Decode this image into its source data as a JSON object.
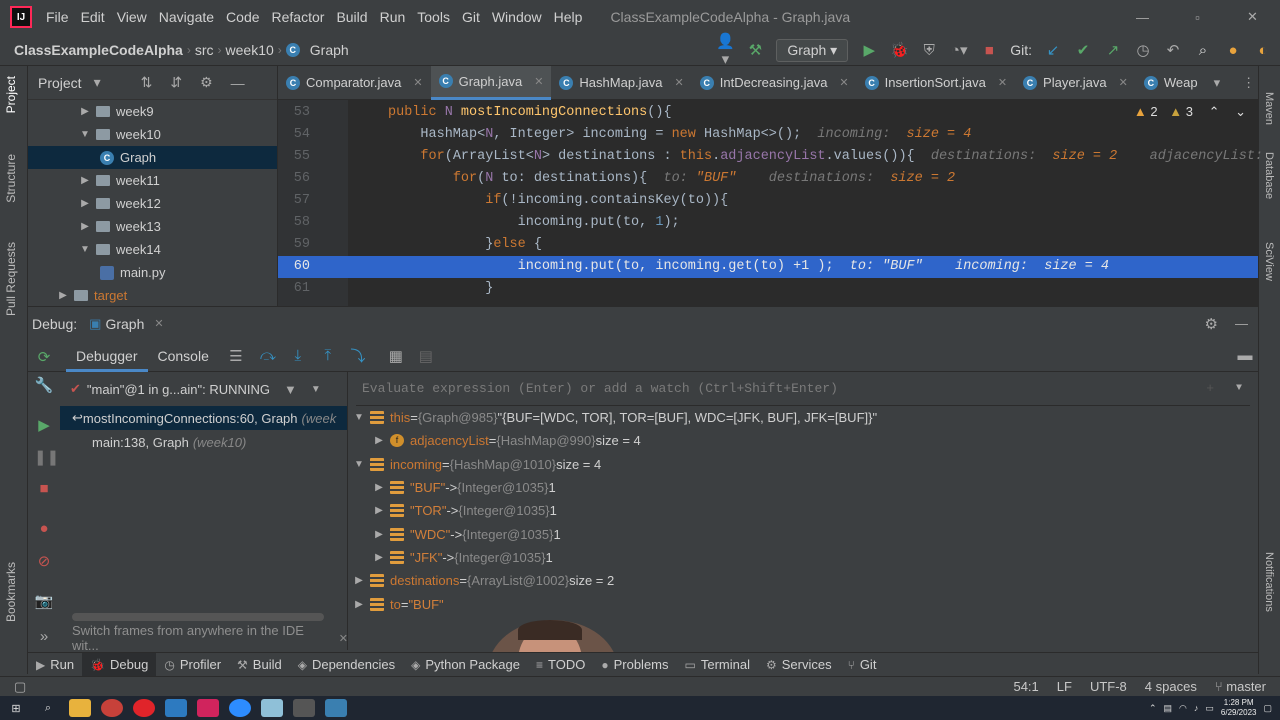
{
  "menubar": {
    "logo": "IJ",
    "items": [
      "File",
      "Edit",
      "View",
      "Navigate",
      "Code",
      "Refactor",
      "Build",
      "Run",
      "Tools",
      "Git",
      "Window",
      "Help"
    ],
    "title": "ClassExampleCodeAlpha - Graph.java",
    "ctrls": [
      "—",
      "▫",
      "✕"
    ]
  },
  "nav": {
    "crumbs": [
      "ClassExampleCodeAlpha",
      "src",
      "week10",
      "Graph"
    ],
    "run_config": "Graph",
    "git_label": "Git:"
  },
  "left_strip": {
    "tabs": [
      "Project",
      "Structure",
      "Pull Requests",
      "Bookmarks"
    ]
  },
  "right_strip": {
    "tabs": [
      "Maven",
      "Database",
      "SciView",
      "Notifications"
    ]
  },
  "project": {
    "title": "Project",
    "items": [
      {
        "label": "week9",
        "expanded": false,
        "kind": "folder",
        "indent": 1
      },
      {
        "label": "week10",
        "expanded": true,
        "kind": "folder",
        "indent": 1
      },
      {
        "label": "Graph",
        "kind": "class",
        "indent": 2,
        "selected": true
      },
      {
        "label": "week11",
        "expanded": false,
        "kind": "folder",
        "indent": 1
      },
      {
        "label": "week12",
        "expanded": false,
        "kind": "folder",
        "indent": 1
      },
      {
        "label": "week13",
        "expanded": false,
        "kind": "folder",
        "indent": 1
      },
      {
        "label": "week14",
        "expanded": true,
        "kind": "folder",
        "indent": 1
      },
      {
        "label": "main.py",
        "kind": "py",
        "indent": 2
      },
      {
        "label": "target",
        "expanded": false,
        "kind": "folder",
        "indent": 0
      }
    ]
  },
  "editor_tabs": [
    {
      "label": "Comparator.java"
    },
    {
      "label": "Graph.java",
      "active": true
    },
    {
      "label": "HashMap.java"
    },
    {
      "label": "IntDecreasing.java"
    },
    {
      "label": "InsertionSort.java"
    },
    {
      "label": "Player.java"
    },
    {
      "label": "Weap"
    }
  ],
  "inspections": {
    "warnings": "2",
    "weak": "3"
  },
  "code": [
    {
      "n": "53",
      "parts": [
        [
          "kw",
          "public "
        ],
        [
          "fld",
          "N "
        ],
        [
          "fn",
          "mostIncomingConnections"
        ],
        [
          "",
          "(){"
        ]
      ]
    },
    {
      "n": "54",
      "parts": [
        [
          "",
          "    HashMap<"
        ],
        [
          "fld",
          "N"
        ],
        [
          "",
          ", Integer> incoming = "
        ],
        [
          "kw",
          "new "
        ],
        [
          "",
          "HashMap<>();  "
        ],
        [
          "hint",
          "incoming:  "
        ],
        [
          "hintv",
          "size = 4"
        ]
      ]
    },
    {
      "n": "55",
      "parts": [
        [
          "",
          "    "
        ],
        [
          "kw",
          "for"
        ],
        [
          "",
          "(ArrayList<"
        ],
        [
          "fld",
          "N"
        ],
        [
          "",
          "> destinations : "
        ],
        [
          "kw",
          "this"
        ],
        [
          "",
          "."
        ],
        [
          "fld",
          "adjacencyList"
        ],
        [
          "",
          ".values()){  "
        ],
        [
          "hint",
          "destinations:  "
        ],
        [
          "hintv",
          "size = 2    "
        ],
        [
          "hint",
          "adjacencyList:"
        ]
      ]
    },
    {
      "n": "56",
      "parts": [
        [
          "",
          "        "
        ],
        [
          "kw",
          "for"
        ],
        [
          "",
          "("
        ],
        [
          "fld",
          "N "
        ],
        [
          "",
          "to: destinations){  "
        ],
        [
          "hint",
          "to: "
        ],
        [
          "hintv",
          "\"BUF\"    "
        ],
        [
          "hint",
          "destinations:  "
        ],
        [
          "hintv",
          "size = 2"
        ]
      ]
    },
    {
      "n": "57",
      "parts": [
        [
          "",
          "            "
        ],
        [
          "kw",
          "if"
        ],
        [
          "",
          "(!incoming.containsKey(to)){"
        ]
      ]
    },
    {
      "n": "58",
      "parts": [
        [
          "",
          "                incoming.put(to, "
        ],
        [
          "num",
          "1"
        ],
        [
          "",
          ");"
        ]
      ]
    },
    {
      "n": "59",
      "parts": [
        [
          "",
          "            }"
        ],
        [
          "kw",
          "else "
        ],
        [
          "",
          "{"
        ]
      ]
    },
    {
      "n": "60",
      "hl": true,
      "parts": [
        [
          "",
          "                incoming.put(to, incoming.get(to) +1 );  "
        ],
        [
          "hint",
          "to: \"BUF\"    incoming:  size = 4"
        ]
      ]
    },
    {
      "n": "61",
      "parts": [
        [
          "",
          "            }"
        ]
      ]
    }
  ],
  "debug": {
    "label": "Debug:",
    "session": "Graph",
    "tabs": [
      "Debugger",
      "Console"
    ],
    "thread": "\"main\"@1 in g...ain\": RUNNING",
    "frames": [
      {
        "method": "mostIncomingConnections:60, Graph",
        "pkg": "(week",
        "selected": true
      },
      {
        "method": "main:138, Graph",
        "pkg": "(week10)"
      }
    ],
    "tip": "Switch frames from anywhere in the IDE wit...",
    "eval_placeholder": "Evaluate expression (Enter) or add a watch (Ctrl+Shift+Enter)",
    "vars": [
      {
        "arrow": "▼",
        "icon": "list",
        "name": "this",
        "eq": " = ",
        "type": "{Graph@985}",
        "val": " \"{BUF=[WDC, TOR], TOR=[BUF], WDC=[JFK, BUF], JFK=[BUF]}\"",
        "indent": 0
      },
      {
        "arrow": "▶",
        "icon": "field",
        "name": "adjacencyList",
        "eq": " = ",
        "type": "{HashMap@990}",
        "val": "  size = 4",
        "indent": 1
      },
      {
        "arrow": "▼",
        "icon": "list",
        "name": "incoming",
        "eq": " = ",
        "type": "{HashMap@1010}",
        "val": "  size = 4",
        "indent": 0
      },
      {
        "arrow": "▶",
        "icon": "list",
        "name": "\"BUF\"",
        "eq": " -> ",
        "type": "{Integer@1035}",
        "val": " 1",
        "indent": 1,
        "str": true
      },
      {
        "arrow": "▶",
        "icon": "list",
        "name": "\"TOR\"",
        "eq": " -> ",
        "type": "{Integer@1035}",
        "val": " 1",
        "indent": 1,
        "str": true
      },
      {
        "arrow": "▶",
        "icon": "list",
        "name": "\"WDC\"",
        "eq": " -> ",
        "type": "{Integer@1035}",
        "val": " 1",
        "indent": 1,
        "str": true
      },
      {
        "arrow": "▶",
        "icon": "list",
        "name": "\"JFK\"",
        "eq": " -> ",
        "type": "{Integer@1035}",
        "val": " 1",
        "indent": 1,
        "str": true
      },
      {
        "arrow": "▶",
        "icon": "list",
        "name": "destinations",
        "eq": " = ",
        "type": "{ArrayList@1002}",
        "val": "  size = 2",
        "indent": 0
      },
      {
        "arrow": "▶",
        "icon": "list",
        "name": "to",
        "eq": " = ",
        "type": "",
        "val": "\"BUF\"",
        "indent": 0,
        "strval": true
      }
    ]
  },
  "bottom_tabs": [
    {
      "icon": "▶",
      "label": "Run"
    },
    {
      "icon": "🐞",
      "label": "Debug",
      "active": true
    },
    {
      "icon": "◷",
      "label": "Profiler"
    },
    {
      "icon": "⚒",
      "label": "Build"
    },
    {
      "icon": "◈",
      "label": "Dependencies"
    },
    {
      "icon": "◈",
      "label": "Python Package"
    },
    {
      "icon": "≡",
      "label": "TODO"
    },
    {
      "icon": "●",
      "label": "Problems"
    },
    {
      "icon": "▭",
      "label": "Terminal"
    },
    {
      "icon": "⚙",
      "label": "Services"
    },
    {
      "icon": "⑂",
      "label": "Git"
    }
  ],
  "status": {
    "pos": "54:1",
    "eol": "LF",
    "enc": "UTF-8",
    "indent": "4 spaces",
    "branch": "master"
  },
  "taskbar": {
    "time": "1:28 PM",
    "date": "6/29/2023"
  },
  "colors": {
    "accent": "#4a88c7",
    "highlight": "#2f65ca",
    "keyword": "#cc7832"
  }
}
